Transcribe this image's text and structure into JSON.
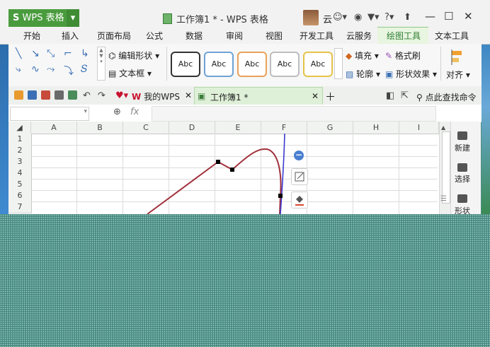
{
  "app": {
    "menu_label": "WPS 表格",
    "logo_letter": "S",
    "document_title": "工作簿1 * - WPS 表格",
    "cloud_label": "云",
    "help_label": "?"
  },
  "tabs": [
    "开始",
    "插入",
    "页面布局",
    "公式",
    "数据",
    "审阅",
    "视图",
    "开发工具",
    "云服务",
    "绘图工具",
    "文本工具"
  ],
  "active_tab": "绘图工具",
  "ribbon": {
    "edit_shape": "编辑形状",
    "text_box": "文本框",
    "style_boxes": [
      {
        "label": "Abc",
        "border": "#333333"
      },
      {
        "label": "Abc",
        "border": "#6fa3d6"
      },
      {
        "label": "Abc",
        "border": "#e8a25a"
      },
      {
        "label": "Abc",
        "border": "#bdbdbd"
      },
      {
        "label": "Abc",
        "border": "#e6c24a"
      }
    ],
    "fill": "填充",
    "outline": "轮廓",
    "format_painter": "格式刷",
    "shape_effects": "形状效果",
    "align": "对齐"
  },
  "quickbar": {
    "my_wps": "我的WPS",
    "book_tab": "工作簿1 *",
    "find_command": "点此查找命令",
    "fx_label": "fx"
  },
  "grid": {
    "columns": [
      "A",
      "B",
      "C",
      "D",
      "E",
      "F",
      "G",
      "H",
      "I"
    ],
    "rows": [
      "1",
      "2",
      "3",
      "4",
      "5",
      "6",
      "7"
    ]
  },
  "side_panel": {
    "new": "新建",
    "select": "选择",
    "shape": "形状"
  },
  "colors": {
    "brand_green": "#4a9b3e",
    "curve": "#a0303c",
    "axis_line": "#3b3bd0",
    "accent_blue": "#4a7fd0"
  }
}
